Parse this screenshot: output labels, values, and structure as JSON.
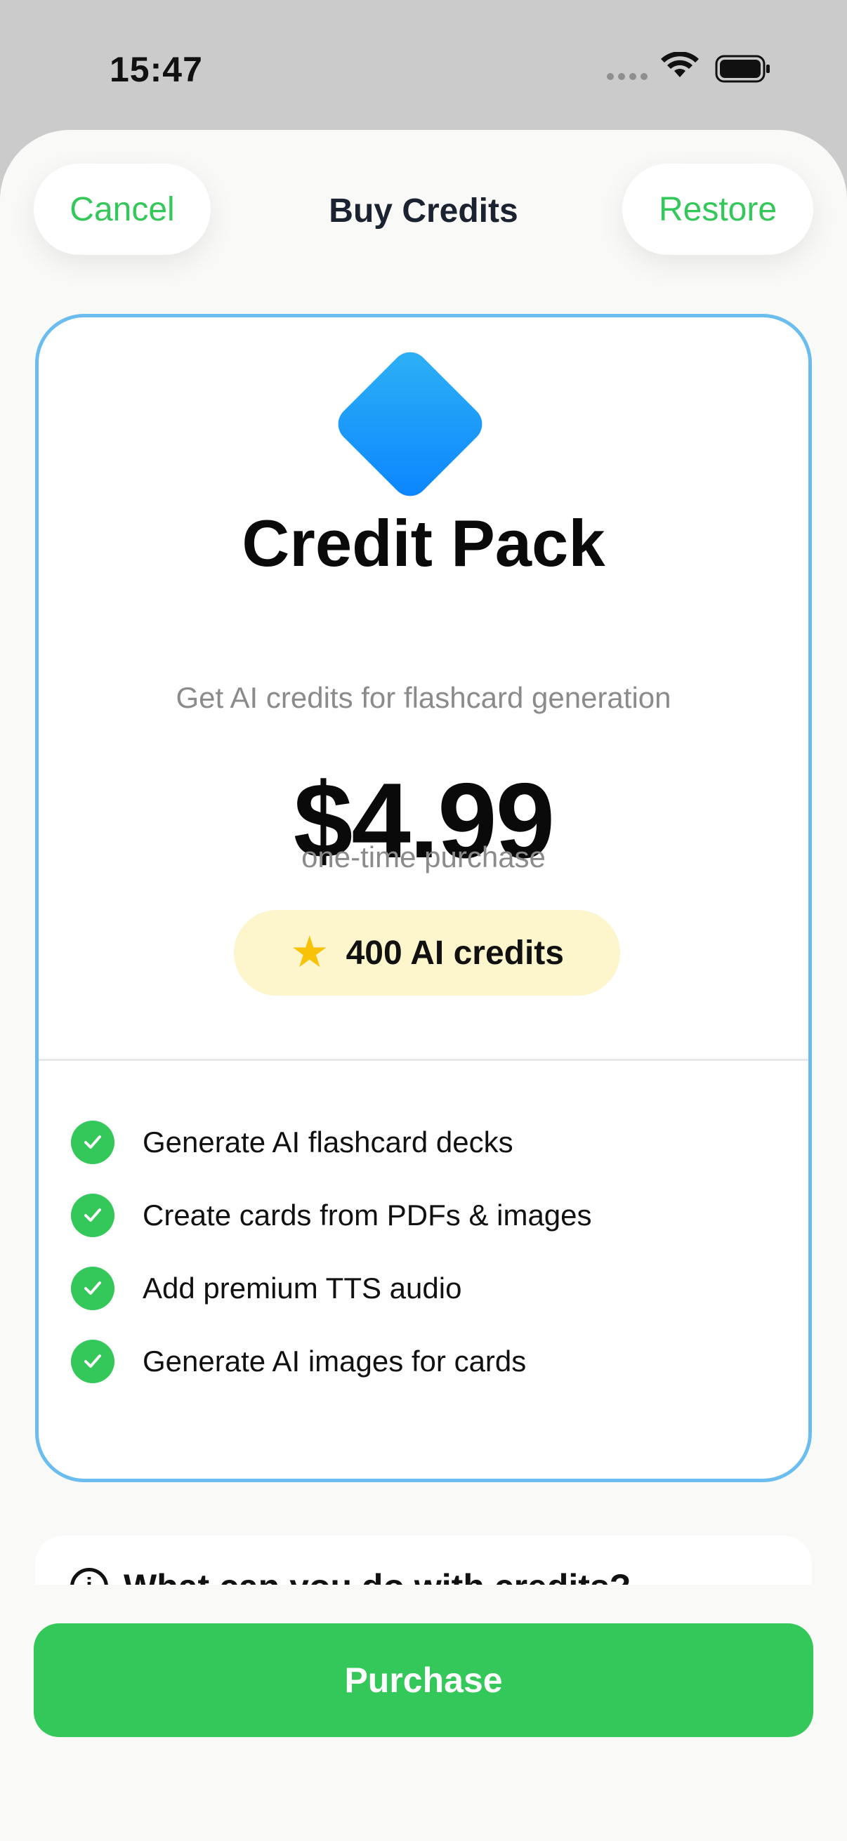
{
  "status_bar": {
    "time": "15:47"
  },
  "nav": {
    "cancel_label": "Cancel",
    "title": "Buy Credits",
    "restore_label": "Restore"
  },
  "product": {
    "icon": "diamond-icon",
    "title": "Credit Pack",
    "subtitle": "Get AI credits for flashcard generation",
    "price": "$4.99",
    "price_note": "one-time purchase",
    "credits_badge": {
      "icon": "star-icon",
      "label": "400 AI credits"
    }
  },
  "features": [
    {
      "icon": "check-icon",
      "label": "Generate AI flashcard decks"
    },
    {
      "icon": "check-icon",
      "label": "Create cards from PDFs & images"
    },
    {
      "icon": "check-icon",
      "label": "Add premium TTS audio"
    },
    {
      "icon": "check-icon",
      "label": "Generate AI images for cards"
    }
  ],
  "info_section": {
    "icon": "info-icon",
    "title": "What can you do with credits?"
  },
  "purchase_button": {
    "label": "Purchase"
  },
  "colors": {
    "accent": "#34c759",
    "card_border": "#6bbdf0",
    "badge_bg": "#fdf5cc",
    "diamond": "#0a84ff"
  }
}
